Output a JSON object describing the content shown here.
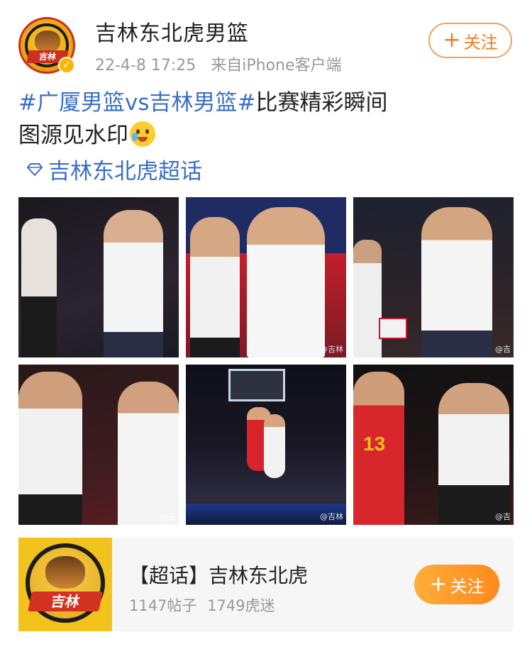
{
  "post": {
    "user_name": "吉林东北虎男篮",
    "timestamp": "22-4-8 17:25",
    "source": "来自iPhone客户端",
    "follow_label": "关注",
    "follow_plus": "+",
    "avatar_text": "吉林",
    "text_topic": "#广厦男篮vs吉林男篮#",
    "text_rest": "比赛精彩瞬间",
    "text_line2": "图源见水印",
    "supertopic_label": "吉林东北虎超话"
  },
  "photos": [
    {
      "watermark": "",
      "palette": [
        "#1d1a1f",
        "#3b3440"
      ]
    },
    {
      "watermark": "@吉林",
      "palette": [
        "#1f2b63",
        "#c41f2c"
      ]
    },
    {
      "watermark": "@吉",
      "palette": [
        "#1e2431",
        "#3a2a2a"
      ]
    },
    {
      "watermark": "@吉",
      "palette": [
        "#2a1819",
        "#5a1c20"
      ]
    },
    {
      "watermark": "@吉林",
      "palette": [
        "#10121a",
        "#3a2233"
      ]
    },
    {
      "watermark": "@吉",
      "palette": [
        "#111111",
        "#3b1a1c"
      ]
    }
  ],
  "card": {
    "title": "【超话】吉林东北虎",
    "posts": "1147帖子",
    "fans": "1749虎迷",
    "follow_label": "关注",
    "follow_plus": "+",
    "logo_text": "吉林"
  },
  "colors": {
    "topic_blue": "#3a6fc4",
    "follow_orange": "#ee7d23",
    "button_orange": "#ff8a1d"
  }
}
